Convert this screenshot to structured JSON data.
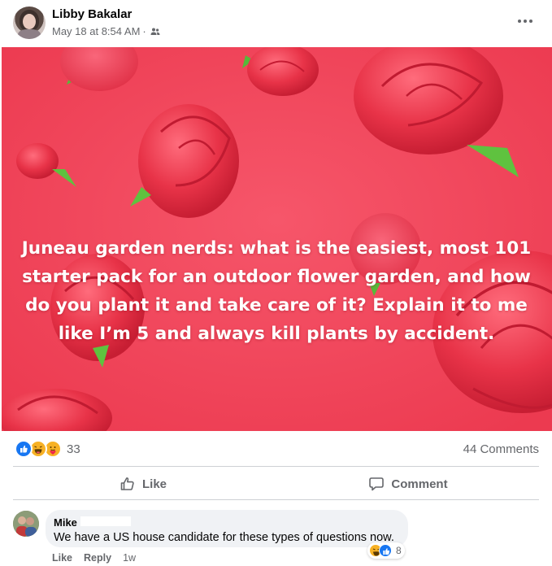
{
  "post": {
    "author": "Libby Bakalar",
    "timestamp": "May 18 at 8:54 AM",
    "separator": "·",
    "text": "Juneau garden nerds: what is the easiest, most 101 starter pack for an outdoor flower garden, and how do you plant it and take care of it? Explain it to me like I’m 5 and always kill plants by accident.",
    "background_color": "#f2465a"
  },
  "reactions": {
    "count": "33",
    "types": [
      "like",
      "haha",
      "care"
    ]
  },
  "comments_count": "44 Comments",
  "actions": {
    "like_label": "Like",
    "comment_label": "Comment"
  },
  "comment": {
    "author": "Mike",
    "text": "We have a US house candidate for these types of questions now.",
    "reaction_count": "8",
    "like_label": "Like",
    "reply_label": "Reply",
    "time": "1w"
  },
  "colors": {
    "accent": "#1877f2",
    "secondary_text": "#65676b",
    "divider": "#ced0d4"
  }
}
